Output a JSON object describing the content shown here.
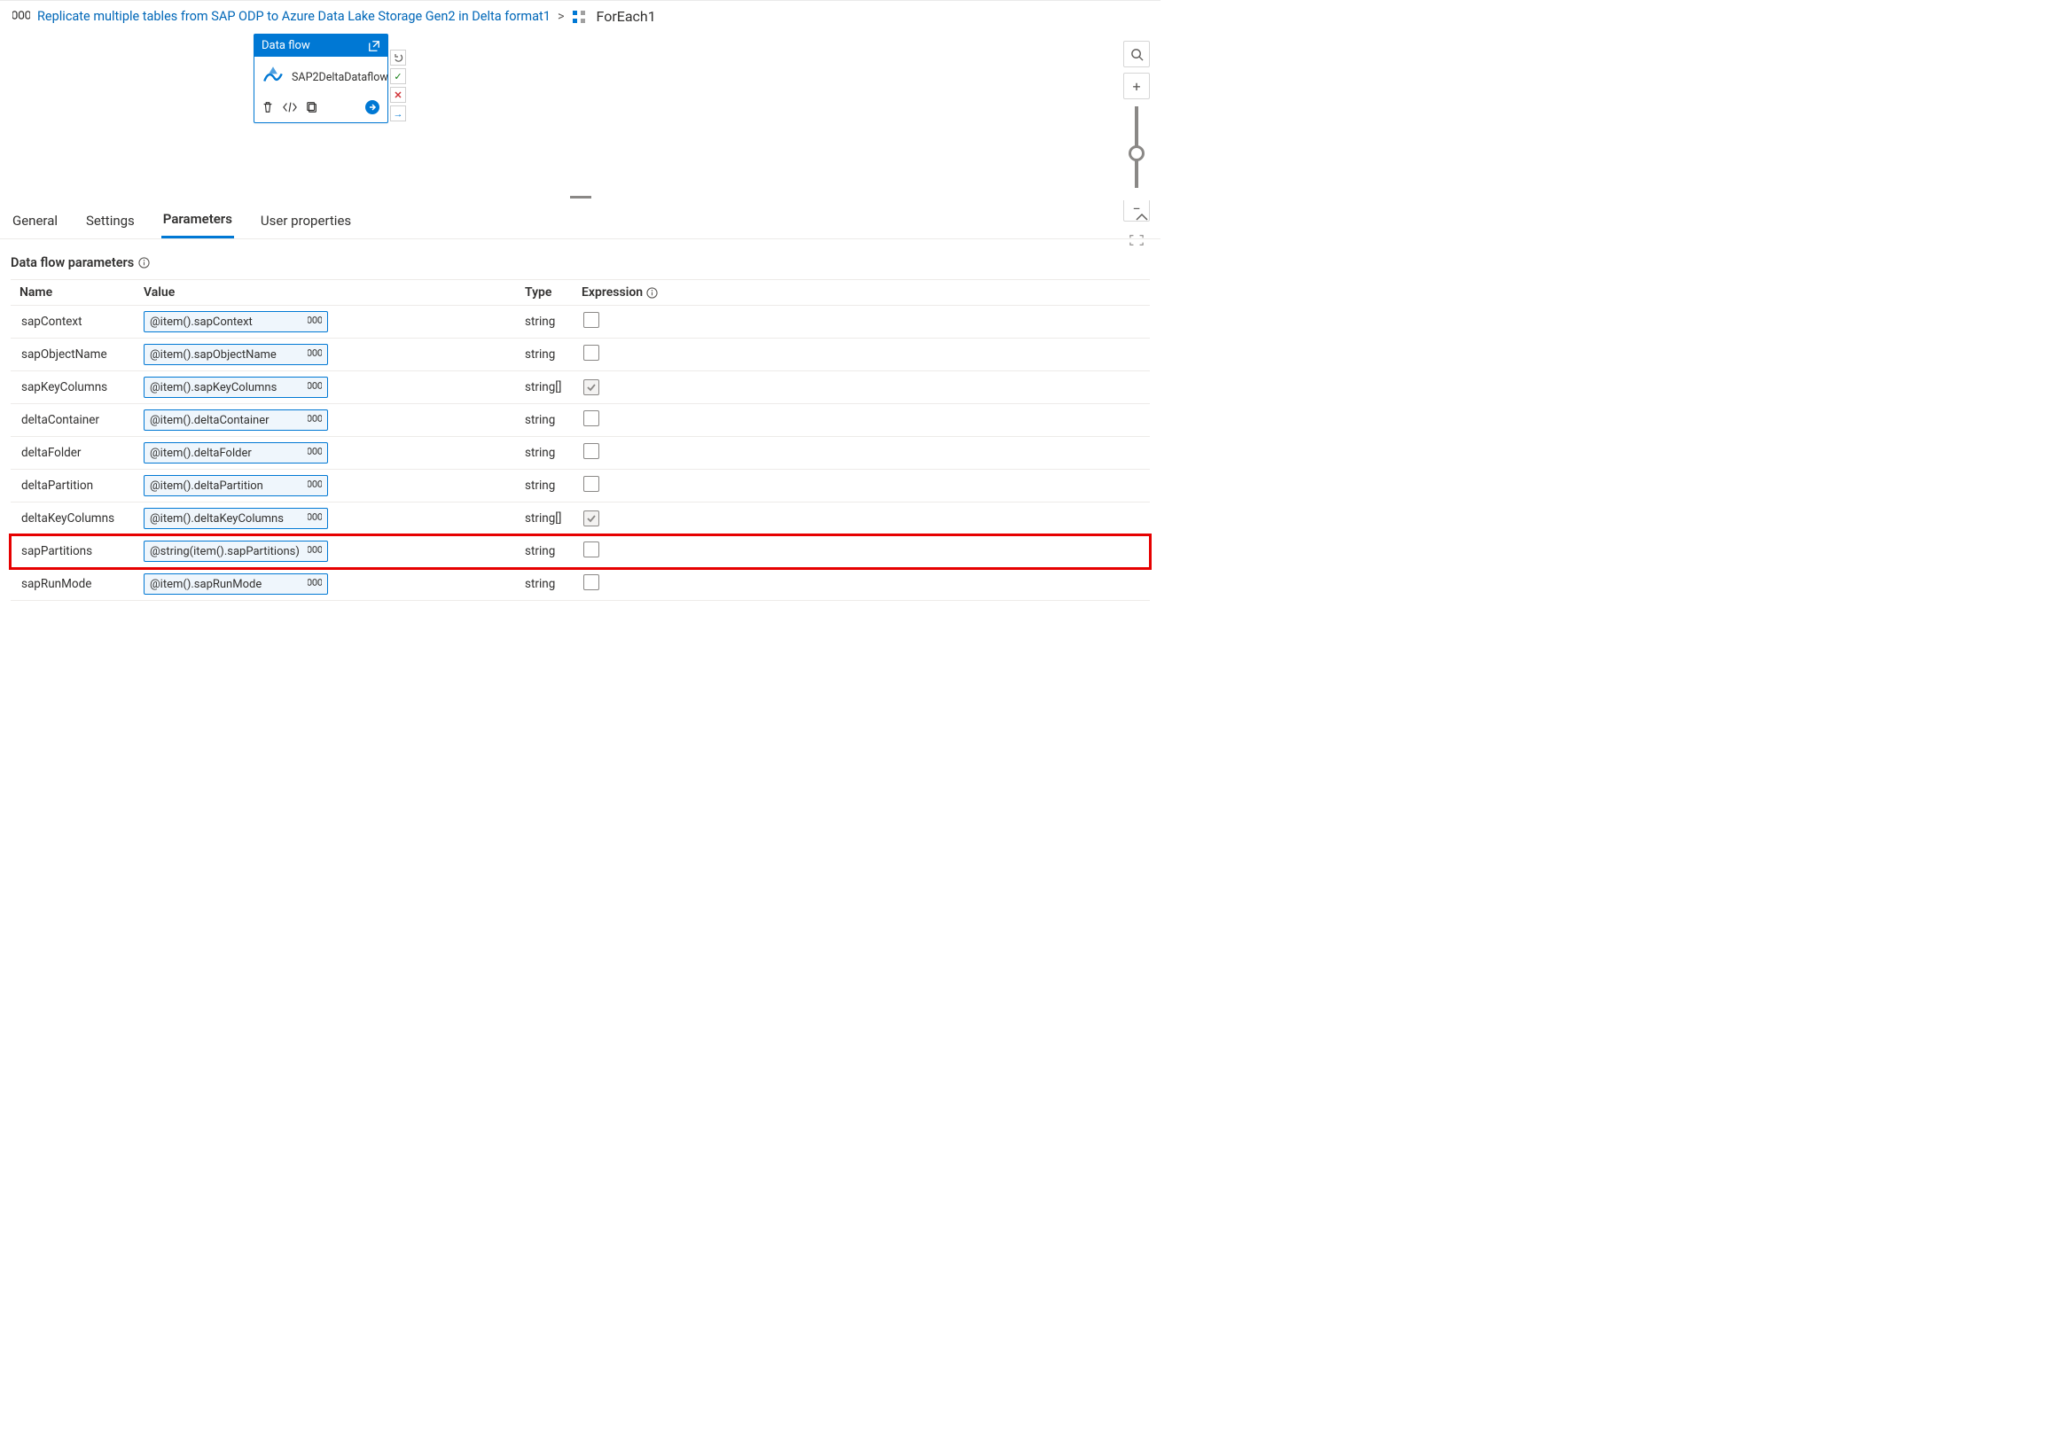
{
  "breadcrumb": {
    "link_text": "Replicate multiple tables from SAP ODP to Azure Data Lake Storage Gen2 in Delta format1",
    "current": "ForEach1"
  },
  "activity": {
    "header": "Data flow",
    "name": "SAP2DeltaDataflow"
  },
  "tabs": {
    "general": "General",
    "settings": "Settings",
    "parameters": "Parameters",
    "user_props": "User properties"
  },
  "section": {
    "title": "Data flow parameters"
  },
  "columns": {
    "name": "Name",
    "value": "Value",
    "type": "Type",
    "expression": "Expression"
  },
  "rows": [
    {
      "name": "sapContext",
      "value": "@item().sapContext",
      "type": "string",
      "checked": false,
      "disabled": false,
      "highlight": false
    },
    {
      "name": "sapObjectName",
      "value": "@item().sapObjectName",
      "type": "string",
      "checked": false,
      "disabled": false,
      "highlight": false
    },
    {
      "name": "sapKeyColumns",
      "value": "@item().sapKeyColumns",
      "type": "string[]",
      "checked": true,
      "disabled": true,
      "highlight": false
    },
    {
      "name": "deltaContainer",
      "value": "@item().deltaContainer",
      "type": "string",
      "checked": false,
      "disabled": false,
      "highlight": false
    },
    {
      "name": "deltaFolder",
      "value": "@item().deltaFolder",
      "type": "string",
      "checked": false,
      "disabled": false,
      "highlight": false
    },
    {
      "name": "deltaPartition",
      "value": "@item().deltaPartition",
      "type": "string",
      "checked": false,
      "disabled": false,
      "highlight": false
    },
    {
      "name": "deltaKeyColumns",
      "value": "@item().deltaKeyColumns",
      "type": "string[]",
      "checked": true,
      "disabled": true,
      "highlight": false
    },
    {
      "name": "sapPartitions",
      "value": "@string(item().sapPartitions)",
      "type": "string",
      "checked": false,
      "disabled": false,
      "highlight": true
    },
    {
      "name": "sapRunMode",
      "value": "@item().sapRunMode",
      "type": "string",
      "checked": false,
      "disabled": false,
      "highlight": false
    }
  ]
}
